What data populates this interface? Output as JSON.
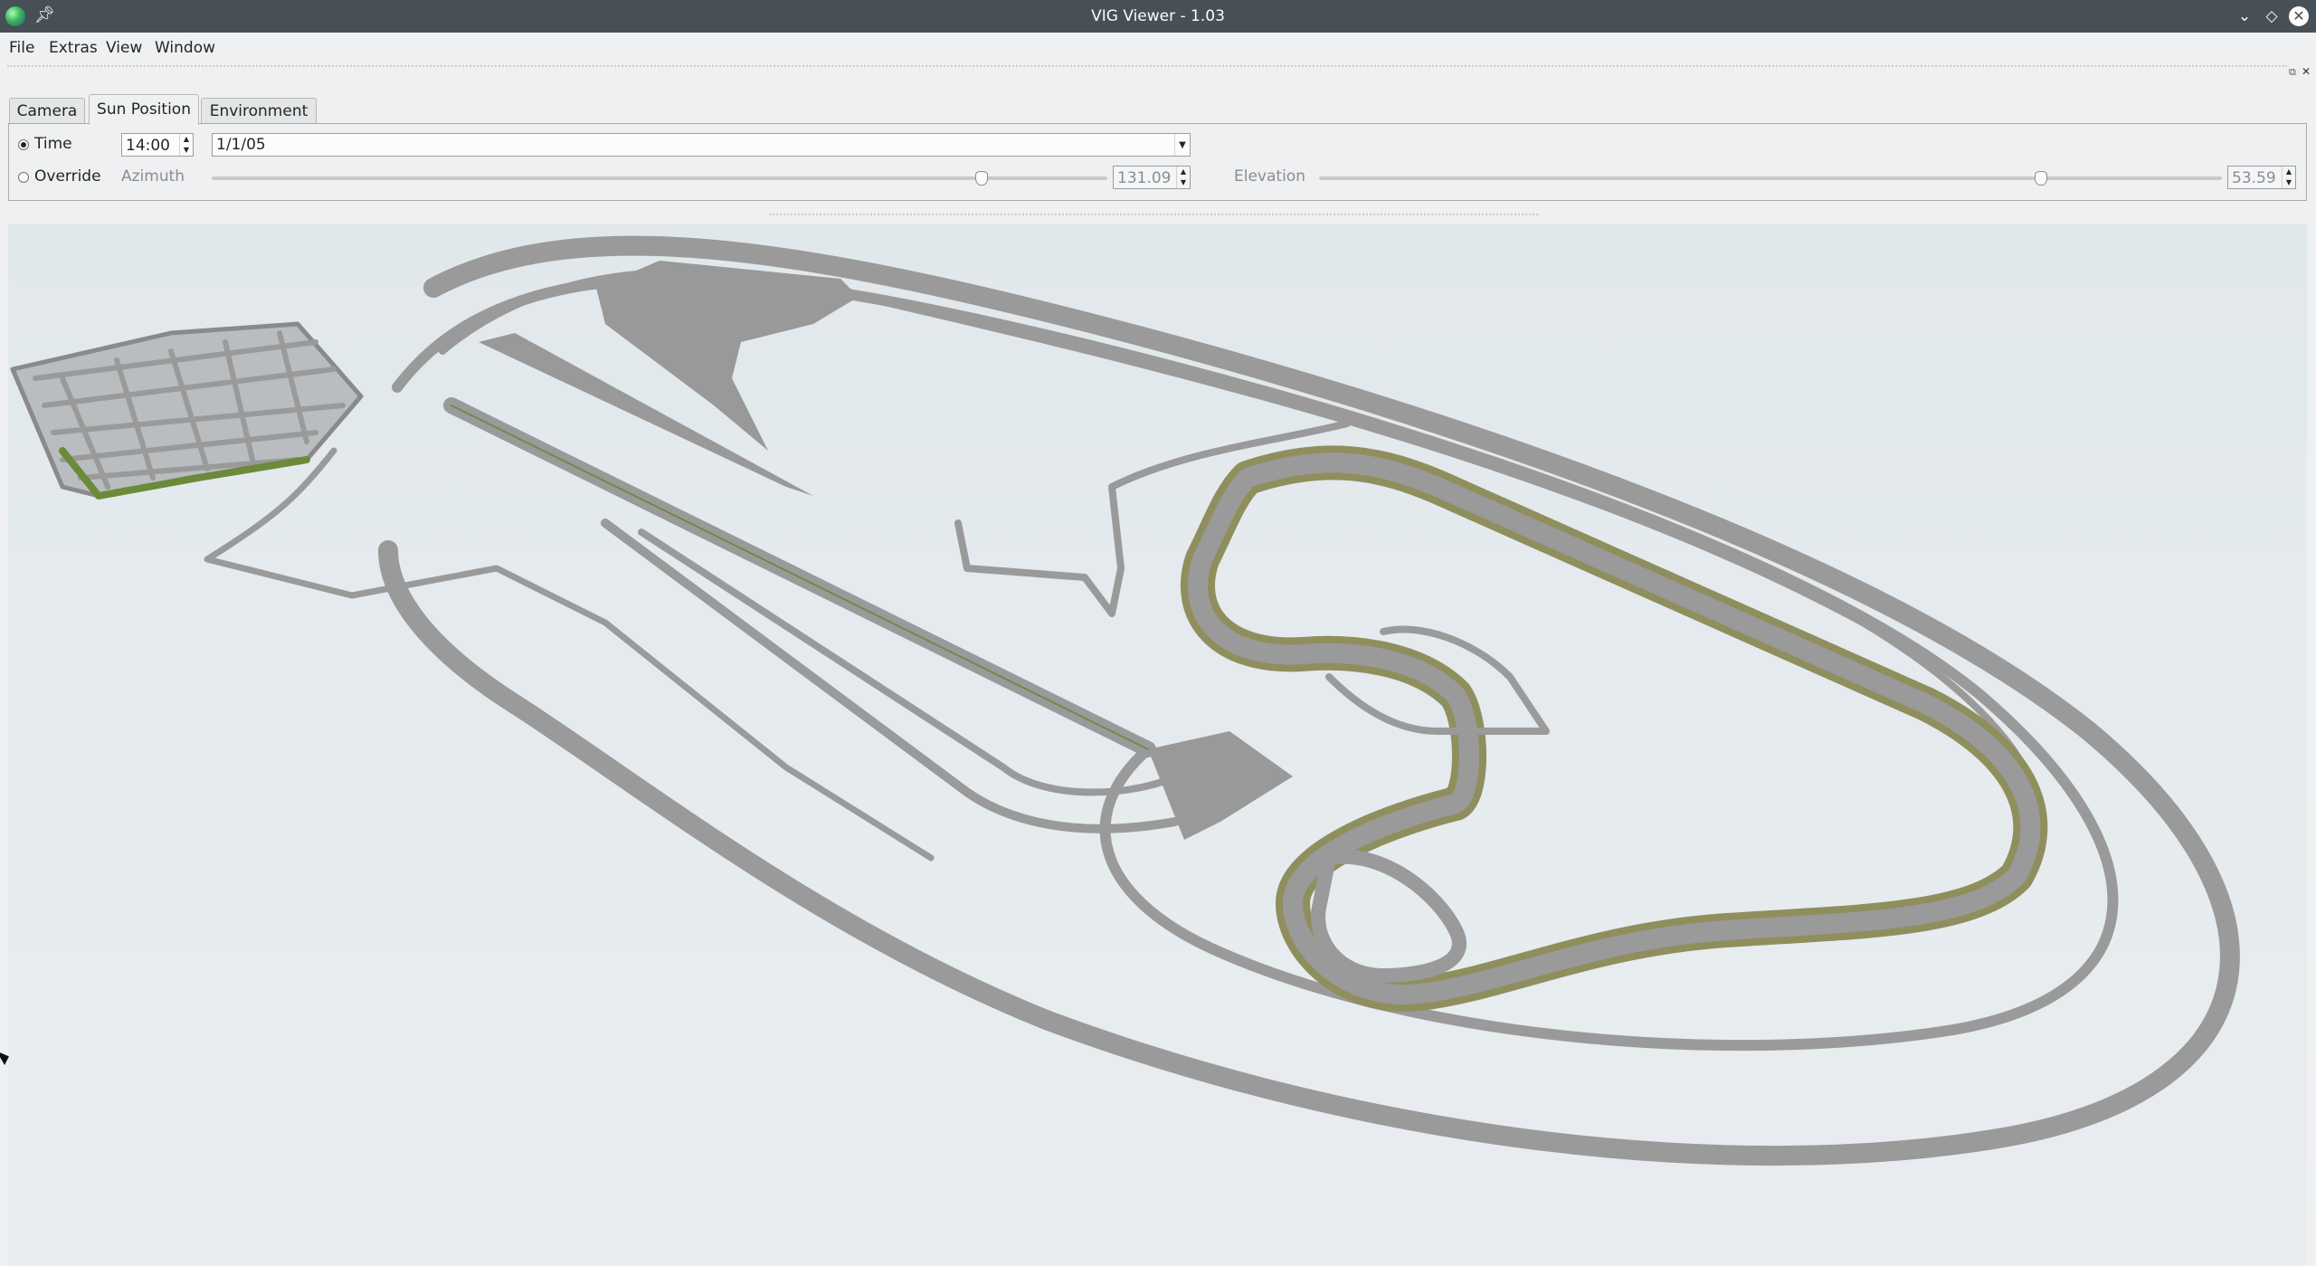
{
  "window": {
    "title": "VIG Viewer - 1.03",
    "icons": [
      "app-globe-icon",
      "pin-icon",
      "minimize-icon",
      "maximize-icon",
      "close-icon"
    ]
  },
  "menu": {
    "file": "File",
    "extras": "Extras",
    "view": "View",
    "window": "Window"
  },
  "tabs": {
    "camera": "Camera",
    "sun_position": "Sun Position",
    "environment": "Environment"
  },
  "sun_panel": {
    "time_label": "Time",
    "time_value": "14:00",
    "date_value": "1/1/05",
    "override_label": "Override",
    "azimuth_label": "Azimuth",
    "azimuth_value": "131.09",
    "azimuth_slider_fraction": 0.86,
    "elevation_label": "Elevation",
    "elevation_value": "53.59",
    "elevation_slider_fraction": 0.8,
    "mode_selected": "time"
  },
  "colors": {
    "titlebar": "#475057",
    "road": "#999999",
    "road_edge": "#8a8a8a",
    "grass_shoulder": "#8f8f5e",
    "vegetation": "#6b8a3a",
    "viewport_bg": "#e5ebee"
  }
}
